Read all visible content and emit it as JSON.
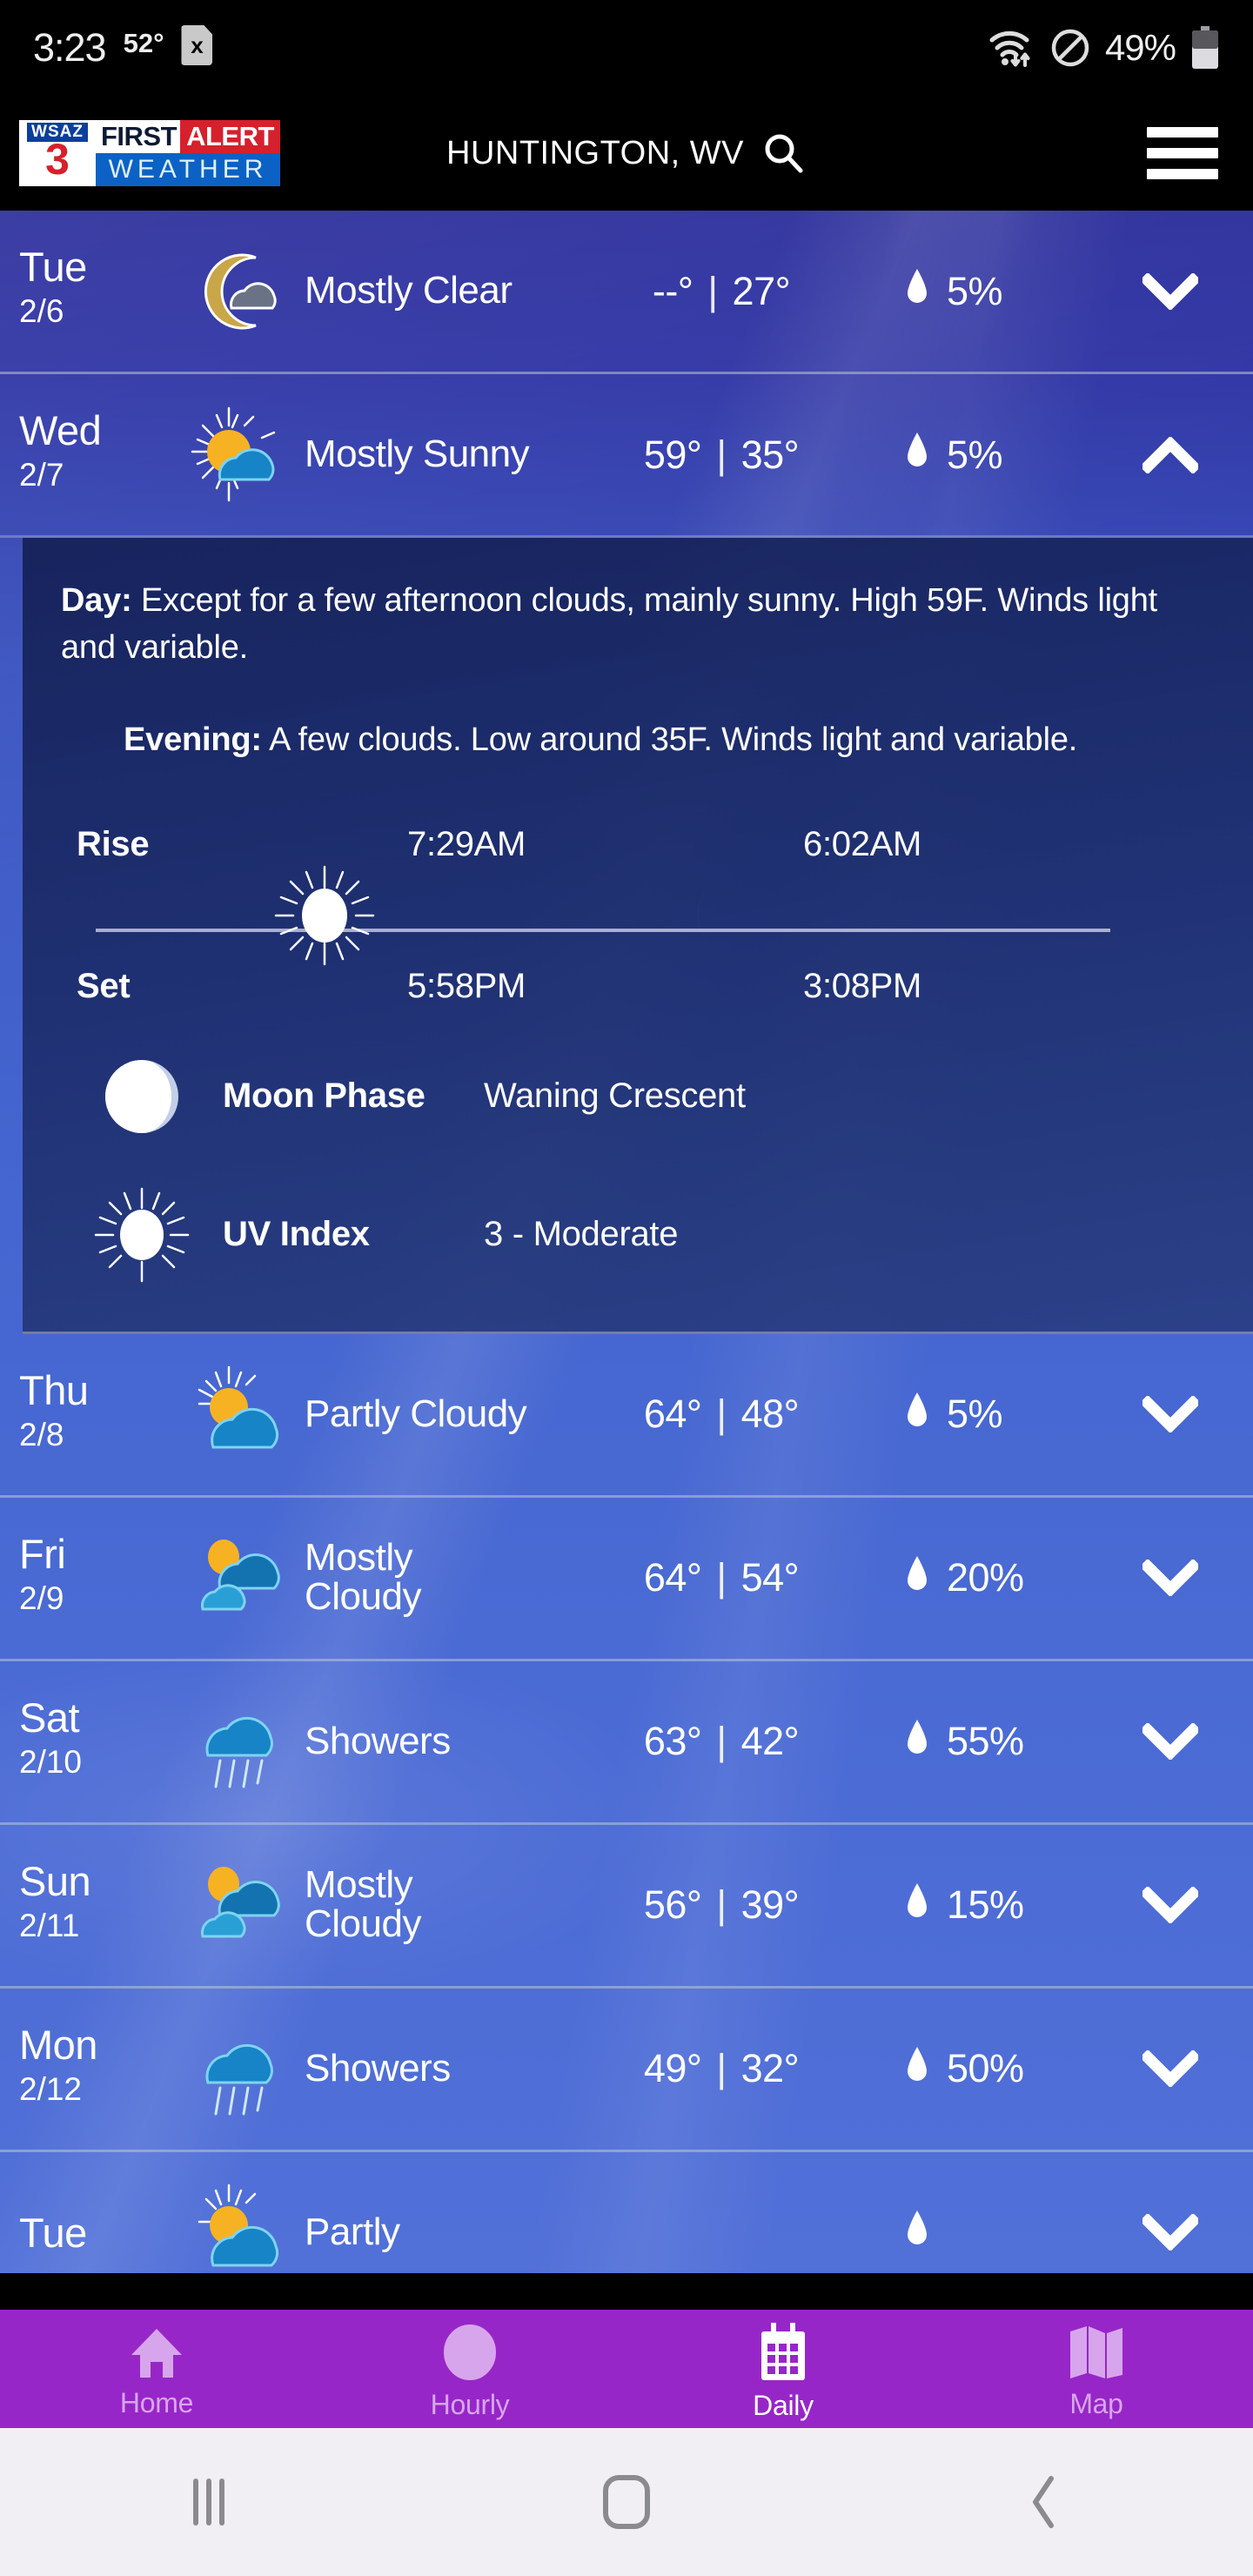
{
  "statusbar": {
    "clock": "3:23",
    "temperature": "52°",
    "sim_icon": "x",
    "wifi_icon": "wifi-updown-icon",
    "dnd_icon": "do-not-disturb-icon",
    "battery_percent": "49%",
    "battery_icon": "battery-half-icon"
  },
  "header": {
    "logo": {
      "station": "WSAZ",
      "channel": "3",
      "first": "FIRST",
      "alert": "ALERT",
      "weather": "WEATHER"
    },
    "location": "HUNTINGTON, WV",
    "search_icon": "search-icon",
    "menu_icon": "hamburger-menu-icon",
    "colors": {
      "alert_red": "#d6202c",
      "weather_blue": "#0b62c4"
    }
  },
  "forecast": [
    {
      "day": "Tue",
      "date": "2/6",
      "condition": "Mostly Clear",
      "icon": "moon-cloud-icon",
      "high": "--°",
      "low": "27°",
      "separator": "|",
      "precip": "5%",
      "precip_icon": "water-drop-icon",
      "chevron": "chevron-down-icon",
      "expanded": false
    },
    {
      "day": "Wed",
      "date": "2/7",
      "condition": "Mostly Sunny",
      "icon": "sun-cloud-icon",
      "high": "59°",
      "low": "35°",
      "separator": "|",
      "precip": "5%",
      "precip_icon": "water-drop-icon",
      "chevron": "chevron-up-icon",
      "expanded": true
    },
    {
      "day": "Thu",
      "date": "2/8",
      "condition": "Partly Cloudy",
      "icon": "sun-cloud-icon",
      "high": "64°",
      "low": "48°",
      "separator": "|",
      "precip": "5%",
      "precip_icon": "water-drop-icon",
      "chevron": "chevron-down-icon",
      "expanded": false
    },
    {
      "day": "Fri",
      "date": "2/9",
      "condition": "Mostly Cloudy",
      "icon": "sun-clouds-icon",
      "high": "64°",
      "low": "54°",
      "separator": "|",
      "precip": "20%",
      "precip_icon": "water-drop-icon",
      "chevron": "chevron-down-icon",
      "expanded": false
    },
    {
      "day": "Sat",
      "date": "2/10",
      "condition": "Showers",
      "icon": "rain-cloud-icon",
      "high": "63°",
      "low": "42°",
      "separator": "|",
      "precip": "55%",
      "precip_icon": "water-drop-icon",
      "chevron": "chevron-down-icon",
      "expanded": false
    },
    {
      "day": "Sun",
      "date": "2/11",
      "condition": "Mostly Cloudy",
      "icon": "sun-clouds-icon",
      "high": "56°",
      "low": "39°",
      "separator": "|",
      "precip": "15%",
      "precip_icon": "water-drop-icon",
      "chevron": "chevron-down-icon",
      "expanded": false
    },
    {
      "day": "Mon",
      "date": "2/12",
      "condition": "Showers",
      "icon": "rain-cloud-icon",
      "high": "49°",
      "low": "32°",
      "separator": "|",
      "precip": "50%",
      "precip_icon": "water-drop-icon",
      "chevron": "chevron-down-icon",
      "expanded": false
    },
    {
      "day": "Tue",
      "date": "",
      "condition": "Partly",
      "icon": "sun-cloud-icon",
      "high": "",
      "low": "",
      "separator": "",
      "precip": "",
      "precip_icon": "water-drop-icon",
      "chevron": "chevron-down-icon",
      "expanded": false
    }
  ],
  "detail": {
    "day_label": "Day:",
    "day_text": " Except for a few afternoon clouds, mainly sunny. High 59F. Winds light and variable.",
    "evening_label": "Evening:",
    "evening_text": " A few clouds. Low around 35F. Winds light and variable.",
    "rise_label": "Rise",
    "set_label": "Set",
    "sun_icon": "sun-icon",
    "moon_icon": "crescent-moon-icon",
    "sun_rise": "7:29AM",
    "sun_set": "5:58PM",
    "moon_rise": "6:02AM",
    "moon_set": "3:08PM",
    "moon_phase_icon": "moon-phase-icon",
    "moon_phase_label": "Moon Phase",
    "moon_phase_value": "Waning Crescent",
    "uv_icon": "uv-sun-icon",
    "uv_label": "UV Index",
    "uv_value": "3 - Moderate"
  },
  "bottomnav": {
    "background": "#9726c8",
    "items": [
      {
        "label": "Home",
        "icon": "home-icon",
        "active": false
      },
      {
        "label": "Hourly",
        "icon": "clock-icon",
        "active": false
      },
      {
        "label": "Daily",
        "icon": "calendar-icon",
        "active": true
      },
      {
        "label": "Map",
        "icon": "map-icon",
        "active": false
      }
    ]
  },
  "sysnav": {
    "recents_icon": "recents-icon",
    "home_icon": "home-circle-icon",
    "back_icon": "back-chevron-icon"
  }
}
